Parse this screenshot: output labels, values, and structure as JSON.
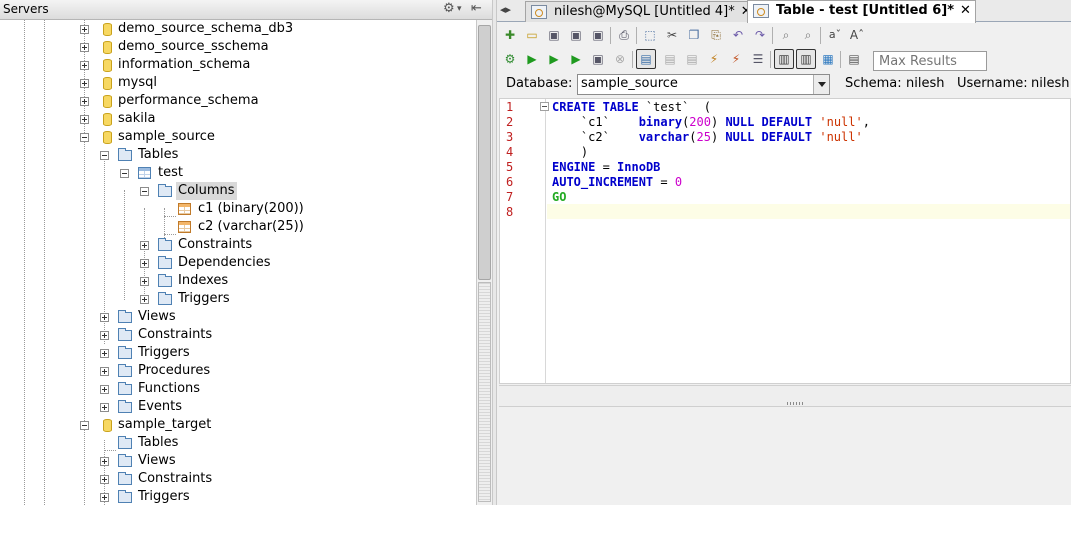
{
  "servers": {
    "title": "Servers",
    "tree": [
      {
        "label": "demo_source_schema_db3",
        "type": "db"
      },
      {
        "label": "demo_source_sschema",
        "type": "db"
      },
      {
        "label": "information_schema",
        "type": "db"
      },
      {
        "label": "mysql",
        "type": "db"
      },
      {
        "label": "performance_schema",
        "type": "db"
      },
      {
        "label": "sakila",
        "type": "db"
      },
      {
        "label": "sample_source",
        "type": "db"
      },
      {
        "label": "Tables",
        "type": "folder"
      },
      {
        "label": "test",
        "type": "table"
      },
      {
        "label": "Columns",
        "type": "folder",
        "selected": true
      },
      {
        "label": "c1 (binary(200))",
        "type": "column"
      },
      {
        "label": "c2 (varchar(25))",
        "type": "column"
      },
      {
        "label": "Constraints",
        "type": "folder"
      },
      {
        "label": "Dependencies",
        "type": "folder"
      },
      {
        "label": "Indexes",
        "type": "folder"
      },
      {
        "label": "Triggers",
        "type": "folder"
      },
      {
        "label": "Views",
        "type": "folder"
      },
      {
        "label": "Constraints",
        "type": "folder"
      },
      {
        "label": "Triggers",
        "type": "folder"
      },
      {
        "label": "Procedures",
        "type": "folder"
      },
      {
        "label": "Functions",
        "type": "folder"
      },
      {
        "label": "Events",
        "type": "folder"
      },
      {
        "label": "sample_target",
        "type": "db"
      },
      {
        "label": "Tables",
        "type": "folder"
      },
      {
        "label": "Views",
        "type": "folder"
      },
      {
        "label": "Constraints",
        "type": "folder"
      },
      {
        "label": "Triggers",
        "type": "folder"
      }
    ]
  },
  "tabs": [
    {
      "label": "nilesh@MySQL [Untitled 4]*",
      "close": "✕"
    },
    {
      "label": "Table - test [Untitled 6]*",
      "close": "✕"
    }
  ],
  "toolbar": {
    "max_results_placeholder": "Max Results",
    "icons": [
      "new-file",
      "open-file",
      "save",
      "save-as",
      "save-all",
      "print",
      "select-area",
      "cut",
      "copy",
      "paste",
      "undo",
      "redo",
      "find",
      "replace",
      "font-smaller",
      "font-larger",
      "run-debug",
      "execute",
      "execute-selection",
      "execute-file",
      "plan",
      "stop",
      "commit",
      "rollback",
      "format",
      "connection",
      "disconnect",
      "history",
      "layout-vertical",
      "layout-horizontal",
      "export",
      "properties"
    ]
  },
  "database_bar": {
    "database_label": "Database:",
    "database_value": "sample_source",
    "schema_label": "Schema:",
    "schema_value": "nilesh",
    "username_label": "Username:",
    "username_value": "nilesh"
  },
  "editor": {
    "line_numbers": [
      "1",
      "2",
      "3",
      "4",
      "5",
      "6",
      "7",
      "8"
    ],
    "lines": [
      [
        {
          "t": "CREATE TABLE",
          "c": "kw"
        },
        {
          "t": " `test`  (",
          "c": ""
        }
      ],
      [
        {
          "t": "    `c1`    ",
          "c": ""
        },
        {
          "t": "binary",
          "c": "ty"
        },
        {
          "t": "(",
          "c": ""
        },
        {
          "t": "200",
          "c": "num"
        },
        {
          "t": ") ",
          "c": ""
        },
        {
          "t": "NULL DEFAULT",
          "c": "kw"
        },
        {
          "t": " ",
          "c": ""
        },
        {
          "t": "'null'",
          "c": "str"
        },
        {
          "t": ",",
          "c": ""
        }
      ],
      [
        {
          "t": "    `c2`    ",
          "c": ""
        },
        {
          "t": "varchar",
          "c": "ty"
        },
        {
          "t": "(",
          "c": ""
        },
        {
          "t": "25",
          "c": "num"
        },
        {
          "t": ") ",
          "c": ""
        },
        {
          "t": "NULL DEFAULT",
          "c": "kw"
        },
        {
          "t": " ",
          "c": ""
        },
        {
          "t": "'null'",
          "c": "str"
        }
      ],
      [
        {
          "t": "    )",
          "c": ""
        }
      ],
      [
        {
          "t": "ENGINE",
          "c": "kw"
        },
        {
          "t": " = ",
          "c": ""
        },
        {
          "t": "InnoDB",
          "c": "kw"
        }
      ],
      [
        {
          "t": "AUTO_INCREMENT",
          "c": "kw"
        },
        {
          "t": " = ",
          "c": ""
        },
        {
          "t": "0",
          "c": "num"
        }
      ],
      [
        {
          "t": "GO",
          "c": "go"
        }
      ],
      [
        {
          "t": "",
          "c": ""
        }
      ]
    ]
  }
}
